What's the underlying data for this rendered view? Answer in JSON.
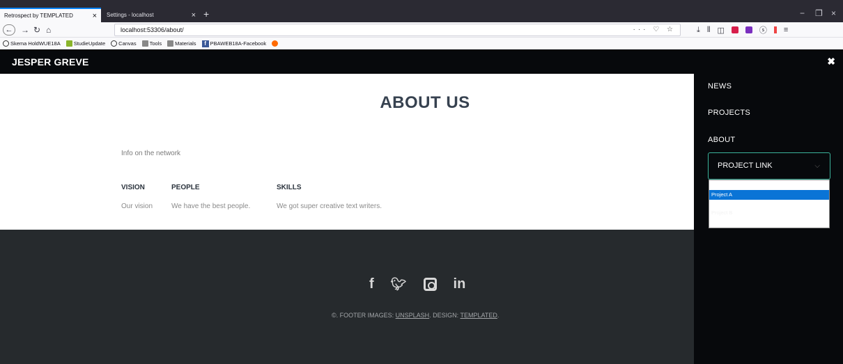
{
  "browser": {
    "tabs": [
      {
        "title": "Retrospect by TEMPLATED",
        "close": "×"
      },
      {
        "title": "Settings - localhost",
        "close": "×"
      }
    ],
    "new_tab": "+",
    "window_controls": [
      "−",
      "❐",
      "×"
    ],
    "url_info": "ⓘ",
    "url": "localhost:53306/about/",
    "url_actions": "··· ♡ ☆",
    "bookmarks": [
      "Skema HoldWUE18A",
      "StudieUpdate",
      "Canvas",
      "Tools",
      "Materials",
      "PBAWEB18A-Facebook"
    ]
  },
  "site": {
    "title": "JESPER GREVE",
    "close": "✖"
  },
  "main": {
    "heading": "ABOUT US",
    "info": "Info on the network",
    "columns": [
      {
        "heading": "VISION",
        "text": "Our vision"
      },
      {
        "heading": "PEOPLE",
        "text": "We have the best people."
      },
      {
        "heading": "SKILLS",
        "text": "We got super creative text writers."
      }
    ]
  },
  "footer": {
    "socials": [
      "facebook-icon",
      "twitter-icon",
      "instagram-icon",
      "linkedin-icon"
    ],
    "copyright_prefix": "©.  FOOTER  IMAGES: ",
    "images_link": "UNSPLASH",
    "design_label": ".  DESIGN: ",
    "design_link": "TEMPLATED"
  },
  "menu": {
    "items": [
      "NEWS",
      "PROJECTS",
      "ABOUT"
    ],
    "select_value": "PROJECT LINK",
    "options": [
      "Project A",
      "Project B"
    ]
  }
}
